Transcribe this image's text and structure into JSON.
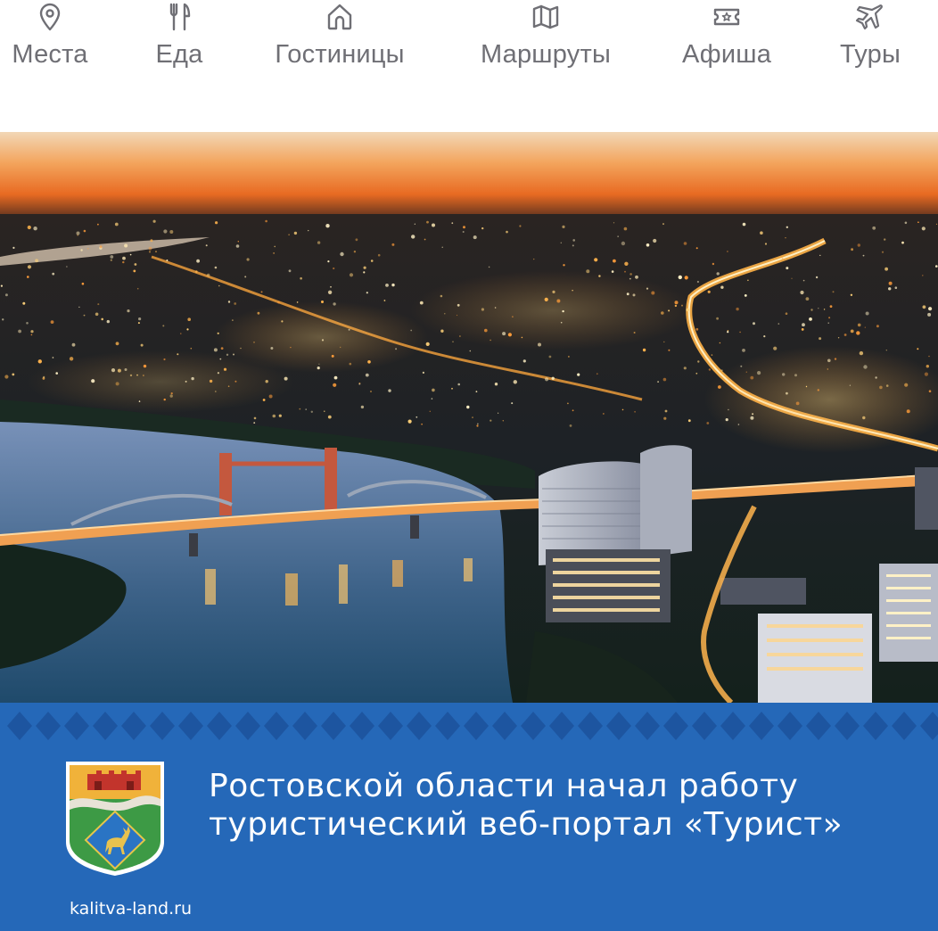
{
  "nav": {
    "items": [
      {
        "label": "Места",
        "icon": "map-pin-icon"
      },
      {
        "label": "Еда",
        "icon": "fork-knife-icon"
      },
      {
        "label": "Гостиницы",
        "icon": "house-icon"
      },
      {
        "label": "Маршруты",
        "icon": "map-icon"
      },
      {
        "label": "Афиша",
        "icon": "ticket-icon"
      },
      {
        "label": "Туры",
        "icon": "airplane-icon"
      }
    ],
    "color": "#6f6f75"
  },
  "hero": {
    "subject": "night-city-aerial-photo"
  },
  "banner": {
    "headline_line1": "Ростовской области начал работу",
    "headline_line2": "туристический веб-портал «Турист»",
    "site": "kalitva-land.ru",
    "background": "#2568b8",
    "ornament_color": "#1d55a0"
  }
}
